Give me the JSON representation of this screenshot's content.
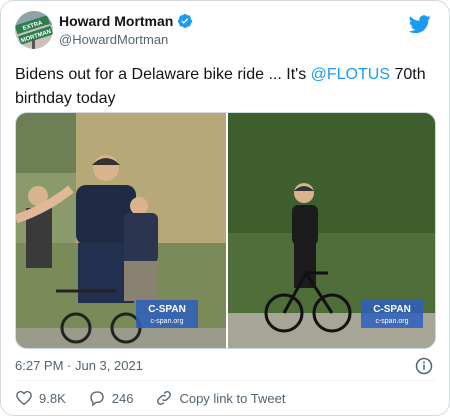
{
  "author": {
    "display_name": "Howard Mortman",
    "handle": "@HowardMortman",
    "avatar_sign_lines": [
      "EXTRA",
      "MORTMAN"
    ]
  },
  "tweet": {
    "text_before": "Bidens out for a Delaware bike ride ... It's ",
    "mention": "@FLOTUS",
    "text_after": " 70th birthday today"
  },
  "media": {
    "left_watermark": {
      "brand": "C-SPAN",
      "url": "c-span.org"
    },
    "right_watermark": {
      "brand": "C-SPAN",
      "url": "c-span.org"
    }
  },
  "timestamp": "6:27 PM · Jun 3, 2021",
  "actions": {
    "likes": "9.8K",
    "replies": "246",
    "copy_link": "Copy link to Tweet"
  },
  "icons": {
    "bird": "twitter-bird-icon",
    "verified": "verified-badge-icon",
    "info": "info-icon",
    "heart": "heart-icon",
    "reply": "reply-icon",
    "link": "link-icon"
  },
  "colors": {
    "accent": "#1d9bf0",
    "secondary_text": "#536471",
    "cspan_blue": "#2d5fbd"
  }
}
